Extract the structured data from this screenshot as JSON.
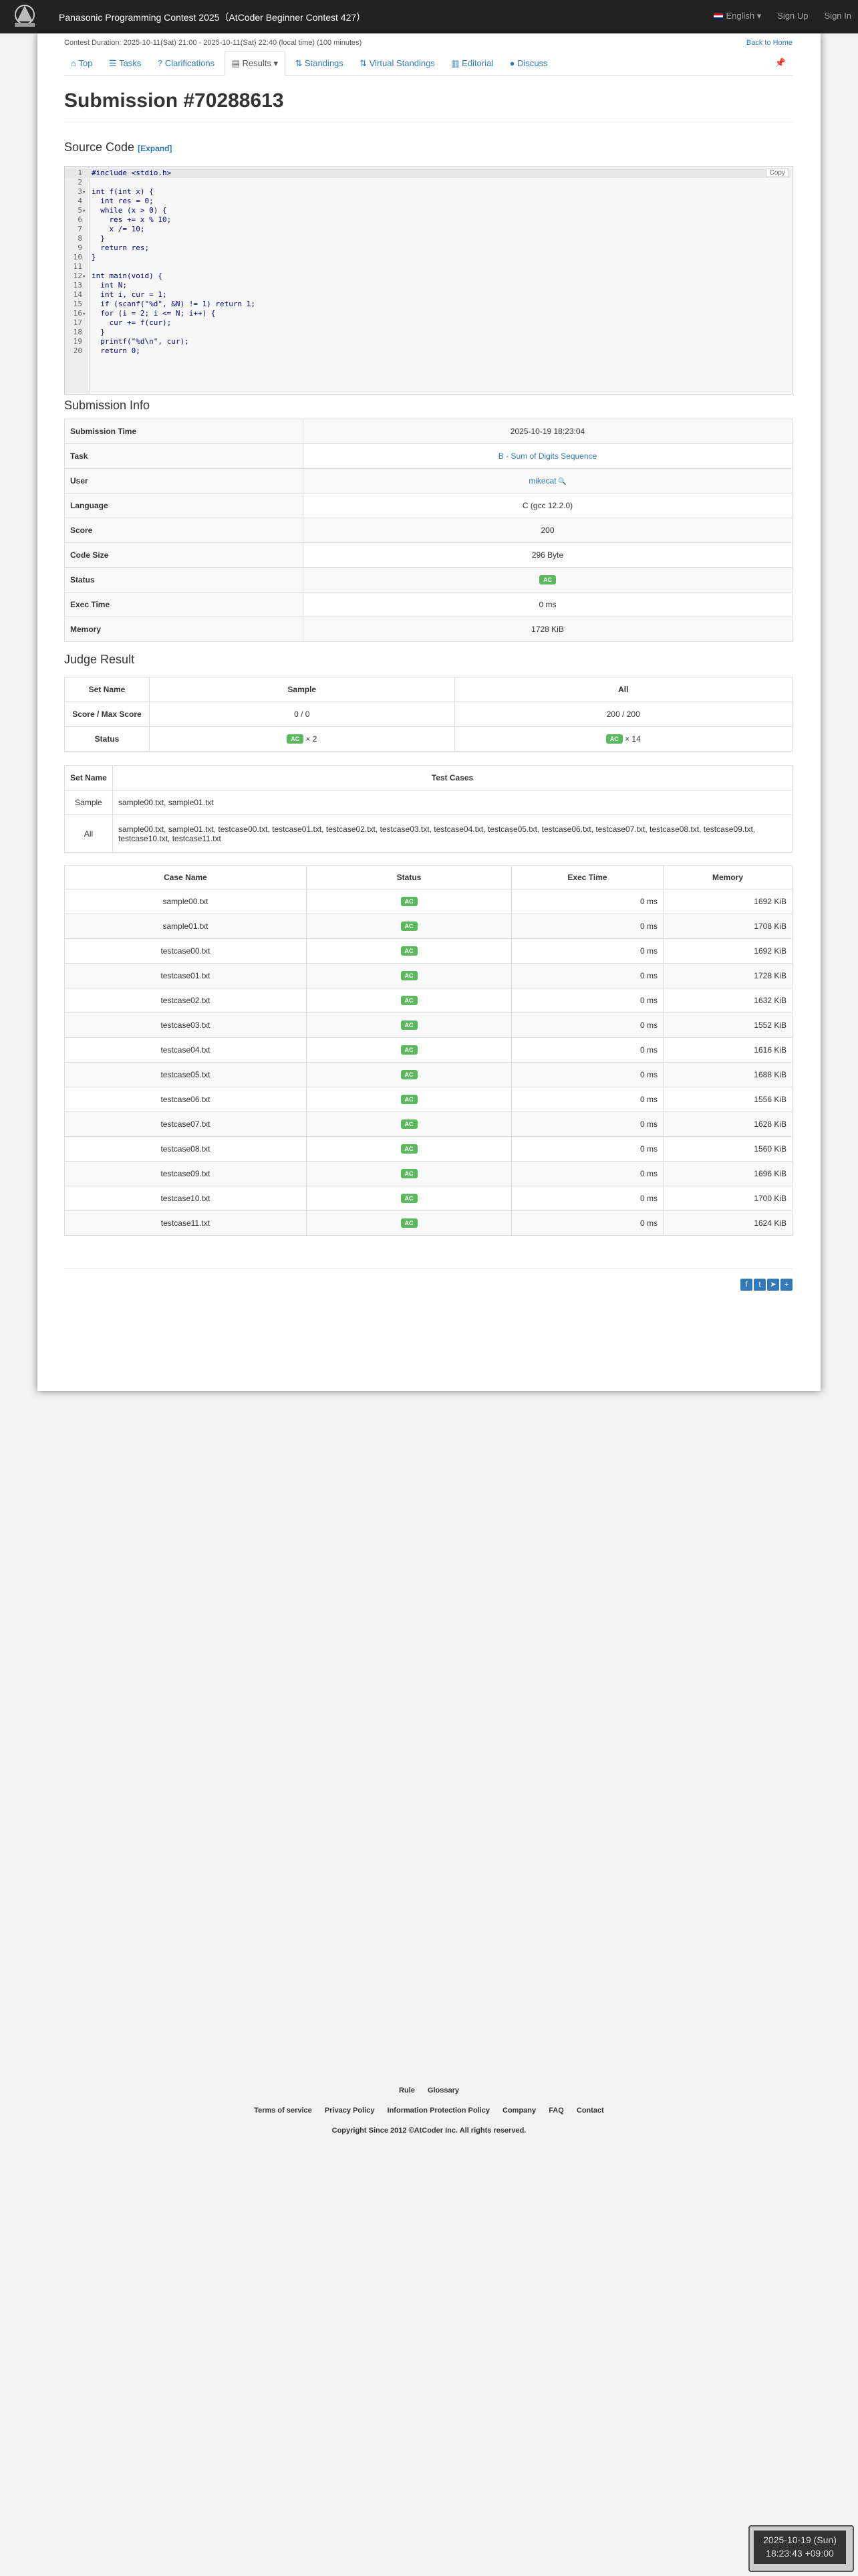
{
  "navbar": {
    "contest_title": "Panasonic Programming Contest 2025（AtCoder Beginner Contest 427）",
    "language": "English",
    "sign_up": "Sign Up",
    "sign_in": "Sign In"
  },
  "header": {
    "duration": "Contest Duration: 2025-10-11(Sat) 21:00 - 2025-10-11(Sat) 22:40 (local time) (100 minutes)",
    "back_home": "Back to Home"
  },
  "tabs": [
    "Top",
    "Tasks",
    "Clarifications",
    "Results",
    "Standings",
    "Virtual Standings",
    "Editorial",
    "Discuss"
  ],
  "title": "Submission #70288613",
  "source_code": {
    "heading": "Source Code",
    "expand": "[Expand]",
    "copy": "Copy",
    "lines": [
      "#include <stdio.h>",
      "",
      "int f(int x) {",
      "  int res = 0;",
      "  while (x > 0) {",
      "    res += x % 10;",
      "    x /= 10;",
      "  }",
      "  return res;",
      "}",
      "",
      "int main(void) {",
      "  int N;",
      "  int i, cur = 1;",
      "  if (scanf(\"%d\", &N) != 1) return 1;",
      "  for (i = 2; i <= N; i++) {",
      "    cur += f(cur);",
      "  }",
      "  printf(\"%d\\n\", cur);",
      "  return 0;"
    ]
  },
  "submission_info": {
    "heading": "Submission Info",
    "rows": [
      {
        "label": "Submission Time",
        "value": "2025-10-19 18:23:04"
      },
      {
        "label": "Task",
        "value": "B - Sum of Digits Sequence"
      },
      {
        "label": "User",
        "value": "mikecat"
      },
      {
        "label": "Language",
        "value": "C (gcc 12.2.0)"
      },
      {
        "label": "Score",
        "value": "200"
      },
      {
        "label": "Code Size",
        "value": "296 Byte"
      },
      {
        "label": "Status",
        "value": "AC"
      },
      {
        "label": "Exec Time",
        "value": "0 ms"
      },
      {
        "label": "Memory",
        "value": "1728 KiB"
      }
    ]
  },
  "judge_result": {
    "heading": "Judge Result",
    "headers": [
      "Set Name",
      "Sample",
      "All"
    ],
    "score_label": "Score / Max Score",
    "sample_score": "0 / 0",
    "all_score": "200 / 200",
    "status_label": "Status",
    "ac": "AC",
    "sample_count": "× 2",
    "all_count": "× 14"
  },
  "test_sets": {
    "headers": [
      "Set Name",
      "Test Cases"
    ],
    "rows": [
      {
        "name": "Sample",
        "cases": "sample00.txt, sample01.txt"
      },
      {
        "name": "All",
        "cases": "sample00.txt, sample01.txt, testcase00.txt, testcase01.txt, testcase02.txt, testcase03.txt, testcase04.txt, testcase05.txt, testcase06.txt, testcase07.txt, testcase08.txt, testcase09.txt, testcase10.txt, testcase11.txt"
      }
    ]
  },
  "cases": {
    "headers": [
      "Case Name",
      "Status",
      "Exec Time",
      "Memory"
    ],
    "rows": [
      {
        "name": "sample00.txt",
        "status": "AC",
        "time": "0 ms",
        "mem": "1692 KiB"
      },
      {
        "name": "sample01.txt",
        "status": "AC",
        "time": "0 ms",
        "mem": "1708 KiB"
      },
      {
        "name": "testcase00.txt",
        "status": "AC",
        "time": "0 ms",
        "mem": "1692 KiB"
      },
      {
        "name": "testcase01.txt",
        "status": "AC",
        "time": "0 ms",
        "mem": "1728 KiB"
      },
      {
        "name": "testcase02.txt",
        "status": "AC",
        "time": "0 ms",
        "mem": "1632 KiB"
      },
      {
        "name": "testcase03.txt",
        "status": "AC",
        "time": "0 ms",
        "mem": "1552 KiB"
      },
      {
        "name": "testcase04.txt",
        "status": "AC",
        "time": "0 ms",
        "mem": "1616 KiB"
      },
      {
        "name": "testcase05.txt",
        "status": "AC",
        "time": "0 ms",
        "mem": "1688 KiB"
      },
      {
        "name": "testcase06.txt",
        "status": "AC",
        "time": "0 ms",
        "mem": "1556 KiB"
      },
      {
        "name": "testcase07.txt",
        "status": "AC",
        "time": "0 ms",
        "mem": "1628 KiB"
      },
      {
        "name": "testcase08.txt",
        "status": "AC",
        "time": "0 ms",
        "mem": "1560 KiB"
      },
      {
        "name": "testcase09.txt",
        "status": "AC",
        "time": "0 ms",
        "mem": "1696 KiB"
      },
      {
        "name": "testcase10.txt",
        "status": "AC",
        "time": "0 ms",
        "mem": "1700 KiB"
      },
      {
        "name": "testcase11.txt",
        "status": "AC",
        "time": "0 ms",
        "mem": "1624 KiB"
      }
    ]
  },
  "footer": {
    "links1": [
      "Rule",
      "Glossary"
    ],
    "links2": [
      "Terms of service",
      "Privacy Policy",
      "Information Protection Policy",
      "Company",
      "FAQ",
      "Contact"
    ],
    "copyright": "Copyright Since 2012 ©AtCoder Inc. All rights reserved."
  },
  "clock": {
    "date": "2025-10-19 (Sun)",
    "time": "18:23:43 +09:00"
  },
  "colors": {
    "navbar": "#222222",
    "link": "#337ab7",
    "ac": "#5cb85c"
  }
}
